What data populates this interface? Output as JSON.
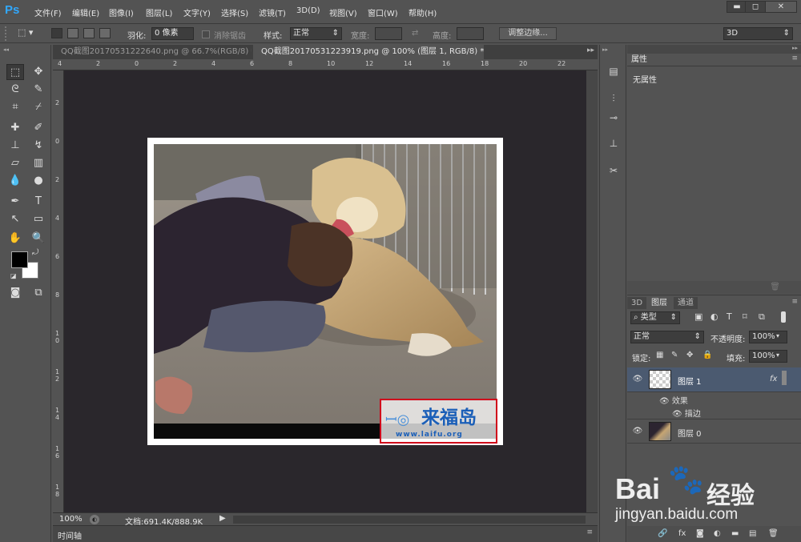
{
  "app": {
    "logo": "Ps"
  },
  "menu": [
    "文件(F)",
    "编辑(E)",
    "图像(I)",
    "图层(L)",
    "文字(Y)",
    "选择(S)",
    "滤镜(T)",
    "3D(D)",
    "视图(V)",
    "窗口(W)",
    "帮助(H)"
  ],
  "window_controls": {
    "minimize": "▬",
    "maximize": "◻",
    "close": "✕"
  },
  "options": {
    "feather_label": "羽化:",
    "feather_value": "0 像素",
    "antialias_label": "消除锯齿",
    "style_label": "样式:",
    "style_value": "正常",
    "width_label": "宽度:",
    "height_label": "高度:",
    "refine_edge": "调整边缘...",
    "workspace": "3D"
  },
  "doc_tabs": [
    {
      "label": "QQ截图20170531222640.png @ 66.7%(RGB/8) *",
      "active": false
    },
    {
      "label": "QQ截图20170531223919.png @ 100% (图层 1, RGB/8) *",
      "active": true
    }
  ],
  "ruler_top": [
    "4",
    "2",
    "0",
    "2",
    "4",
    "6",
    "8",
    "10",
    "12",
    "14",
    "16",
    "18",
    "20",
    "22"
  ],
  "ruler_left": [
    "2",
    "0",
    "2",
    "4",
    "6",
    "8",
    "1 0",
    "1 2",
    "1 4",
    "1 6",
    "1 8"
  ],
  "status": {
    "zoom": "100%",
    "doc_info": "文档:691.4K/888.9K"
  },
  "timeline_label": "时间轴",
  "properties": {
    "tab": "属性",
    "content": "无属性"
  },
  "layers_panel": {
    "tabs": [
      "3D",
      "图层",
      "通道"
    ],
    "filter_kind": "类型",
    "blend_mode": "正常",
    "opacity_label": "不透明度:",
    "opacity_value": "100%",
    "lock_label": "锁定:",
    "fill_label": "填充:",
    "fill_value": "100%",
    "layers": [
      {
        "name": "图层 1",
        "fx": "fx",
        "selected": true
      },
      {
        "name": "图层 0",
        "selected": false
      }
    ],
    "effects_label": "效果",
    "stroke_label": "描边"
  },
  "image_watermark": {
    "title": "来福岛",
    "url": "www.laifu.org"
  },
  "site_watermark": {
    "brand": "Bai",
    "brand2": "经验",
    "url": "jingyan.baidu.com"
  },
  "colors": {
    "accent": "#31a8ff",
    "canvas_bg": "#2a272c",
    "panel": "#535353",
    "selected_layer": "#4b5a70",
    "stamp_border": "#d0021b"
  }
}
